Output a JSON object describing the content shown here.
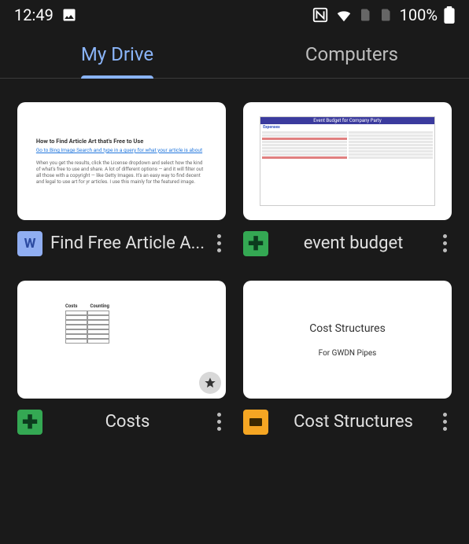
{
  "status": {
    "time": "12:49",
    "battery": "100%"
  },
  "tabs": {
    "my_drive": "My Drive",
    "computers": "Computers",
    "active": "my_drive"
  },
  "files": [
    {
      "name": "Find Free Article A...",
      "type": "word",
      "thumb": {
        "kind": "doc",
        "title": "How to Find Article Art that's Free to Use",
        "sub": "Go to Bing Image Search and type in a query for what your article is about"
      }
    },
    {
      "name": "event budget",
      "type": "sheets",
      "thumb": {
        "kind": "sheet_budget",
        "header": "Event Budget for Company Party",
        "sub": "Expenses"
      }
    },
    {
      "name": "Costs",
      "type": "sheets",
      "starred": true,
      "thumb": {
        "kind": "sheet_costs",
        "col1": "Costs",
        "col2": "Counting"
      }
    },
    {
      "name": "Cost Structures",
      "type": "slides",
      "thumb": {
        "kind": "slide",
        "title": "Cost Structures",
        "sub": "For GWDN Pipes"
      }
    }
  ]
}
